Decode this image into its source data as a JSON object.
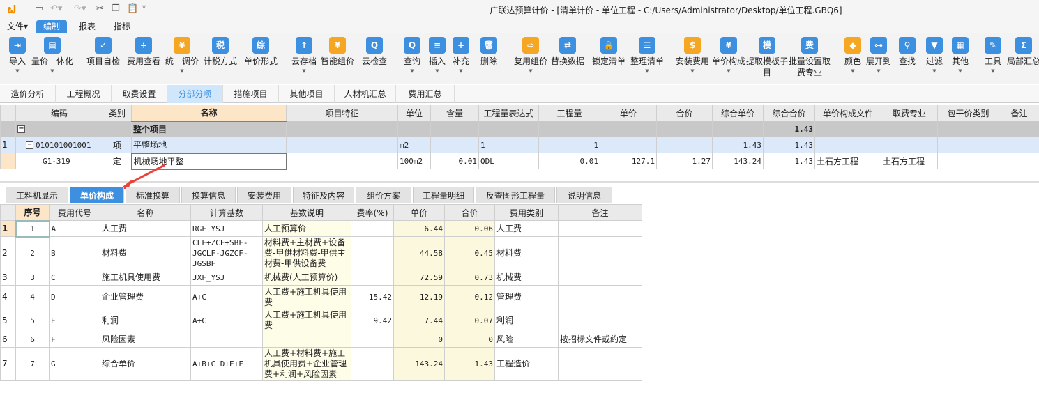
{
  "window": {
    "title": "广联达预算计价 - [清单计价 - 单位工程 - C:/Users/Administrator/Desktop/单位工程.GBQ6]"
  },
  "menu": [
    "文件▾",
    "编制",
    "报表",
    "指标"
  ],
  "toolbar": [
    {
      "label": "导入",
      "icon": "import-icon",
      "g": "⇥",
      "dd": true
    },
    {
      "label": "量价一体化",
      "icon": "integration-icon",
      "g": "▤",
      "dd": true
    },
    {
      "label": "项目自检",
      "icon": "self-check-icon",
      "g": "✓"
    },
    {
      "label": "费用查看",
      "icon": "fee-view-icon",
      "g": "÷"
    },
    {
      "label": "统一调价",
      "icon": "adjust-price-icon",
      "g": "¥",
      "dd": true
    },
    {
      "label": "计税方式",
      "icon": "tax-method-icon",
      "g": "税"
    },
    {
      "label": "单价形式",
      "icon": "price-form-icon",
      "g": "综"
    },
    {
      "label": "云存档",
      "icon": "cloud-save-icon",
      "g": "↑",
      "dd": true
    },
    {
      "label": "智能组价",
      "icon": "smart-price-icon",
      "g": "¥"
    },
    {
      "label": "云检查",
      "icon": "cloud-check-icon",
      "g": "Q"
    },
    {
      "label": "查询",
      "icon": "query-icon",
      "g": "Q",
      "dd": true
    },
    {
      "label": "插入",
      "icon": "insert-icon",
      "g": "≡",
      "dd": true
    },
    {
      "label": "补充",
      "icon": "supplement-icon",
      "g": "+",
      "dd": true
    },
    {
      "label": "删除",
      "icon": "delete-icon",
      "g": "🗑"
    },
    {
      "label": "复用组价",
      "icon": "reuse-price-icon",
      "g": "⇨",
      "dd": true
    },
    {
      "label": "替换数据",
      "icon": "replace-data-icon",
      "g": "⇄"
    },
    {
      "label": "锁定清单",
      "icon": "lock-icon",
      "g": "🔒"
    },
    {
      "label": "整理清单",
      "icon": "organize-icon",
      "g": "☰",
      "dd": true
    },
    {
      "label": "安装费用",
      "icon": "install-fee-icon",
      "g": "$",
      "dd": true
    },
    {
      "label": "单价构成",
      "icon": "price-composition-icon",
      "g": "¥",
      "dd": true
    },
    {
      "label": "提取模板子目",
      "icon": "template-icon",
      "g": "模"
    },
    {
      "label": "批量设置取费专业",
      "icon": "batch-fee-icon",
      "g": "费"
    },
    {
      "label": "颜色",
      "icon": "color-icon",
      "g": "◆",
      "dd": true
    },
    {
      "label": "展开到",
      "icon": "expand-icon",
      "g": "⊶",
      "dd": true
    },
    {
      "label": "查找",
      "icon": "find-icon",
      "g": "⚲"
    },
    {
      "label": "过滤",
      "icon": "filter-icon",
      "g": "▼",
      "dd": true
    },
    {
      "label": "其他",
      "icon": "other-icon",
      "g": "▦",
      "dd": true
    },
    {
      "label": "工具",
      "icon": "tool-icon",
      "g": "✎",
      "dd": true
    },
    {
      "label": "局部汇总",
      "icon": "partial-sum-icon",
      "g": "Σ"
    }
  ],
  "view_tabs": [
    "造价分析",
    "工程概况",
    "取费设置",
    "分部分项",
    "措施项目",
    "其他项目",
    "人材机汇总",
    "费用汇总"
  ],
  "main_table": {
    "headers": [
      "编码",
      "类别",
      "名称",
      "项目特征",
      "单位",
      "含量",
      "工程量表达式",
      "工程量",
      "单价",
      "合价",
      "综合单价",
      "综合合价",
      "单价构成文件",
      "取费专业",
      "包干价类别",
      "备注"
    ],
    "group_row": {
      "name": "整个项目",
      "total": "1.43"
    },
    "rows": [
      {
        "no": "1",
        "code": "010101001001",
        "type": "项",
        "name": "平整场地",
        "unit": "m2",
        "content": "",
        "expr": "1",
        "qty": "1",
        "price": "",
        "sum": "",
        "unit_total": "1.43",
        "total": "1.43",
        "file": "",
        "spec": ""
      },
      {
        "no": "",
        "code": "G1-319",
        "type": "定",
        "name": "机械场地平整",
        "unit": "100m2",
        "content": "0.01",
        "expr": "QDL",
        "qty": "0.01",
        "price": "127.1",
        "sum": "1.27",
        "unit_total": "143.24",
        "total": "1.43",
        "file": "土石方工程",
        "spec": "土石方工程"
      }
    ]
  },
  "bottom_tabs": [
    "工料机显示",
    "单价构成",
    "标准换算",
    "换算信息",
    "安装费用",
    "特征及内容",
    "组价方案",
    "工程量明细",
    "反查图形工程量",
    "说明信息"
  ],
  "sub_table": {
    "headers": [
      "序号",
      "费用代号",
      "名称",
      "计算基数",
      "基数说明",
      "费率(%)",
      "单价",
      "合价",
      "费用类别",
      "备注"
    ],
    "rows": [
      [
        "1",
        "1",
        "A",
        "人工费",
        "RGF_YSJ",
        "人工预算价",
        "",
        "6.44",
        "0.06",
        "人工费",
        ""
      ],
      [
        "2",
        "2",
        "B",
        "材料费",
        "CLF+ZCF+SBF-JGCLF-JGZCF-JGSBF",
        "材料费+主材费+设备费-甲供材料费-甲供主材费-甲供设备费",
        "",
        "44.58",
        "0.45",
        "材料费",
        ""
      ],
      [
        "3",
        "3",
        "C",
        "施工机具使用费",
        "JXF_YSJ",
        "机械费(人工预算价)",
        "",
        "72.59",
        "0.73",
        "机械费",
        ""
      ],
      [
        "4",
        "4",
        "D",
        "企业管理费",
        "A+C",
        "人工费+施工机具使用费",
        "15.42",
        "12.19",
        "0.12",
        "管理费",
        ""
      ],
      [
        "5",
        "5",
        "E",
        "利润",
        "A+C",
        "人工费+施工机具使用费",
        "9.42",
        "7.44",
        "0.07",
        "利润",
        ""
      ],
      [
        "6",
        "6",
        "F",
        "风险因素",
        "",
        "",
        "",
        "0",
        "0",
        "风险",
        "按招标文件或约定"
      ],
      [
        "7",
        "7",
        "G",
        "综合单价",
        "A+B+C+D+E+F",
        "人工费+材料费+施工机具使用费+企业管理费+利润+风险因素",
        "",
        "143.24",
        "1.43",
        "工程造价",
        ""
      ]
    ]
  }
}
